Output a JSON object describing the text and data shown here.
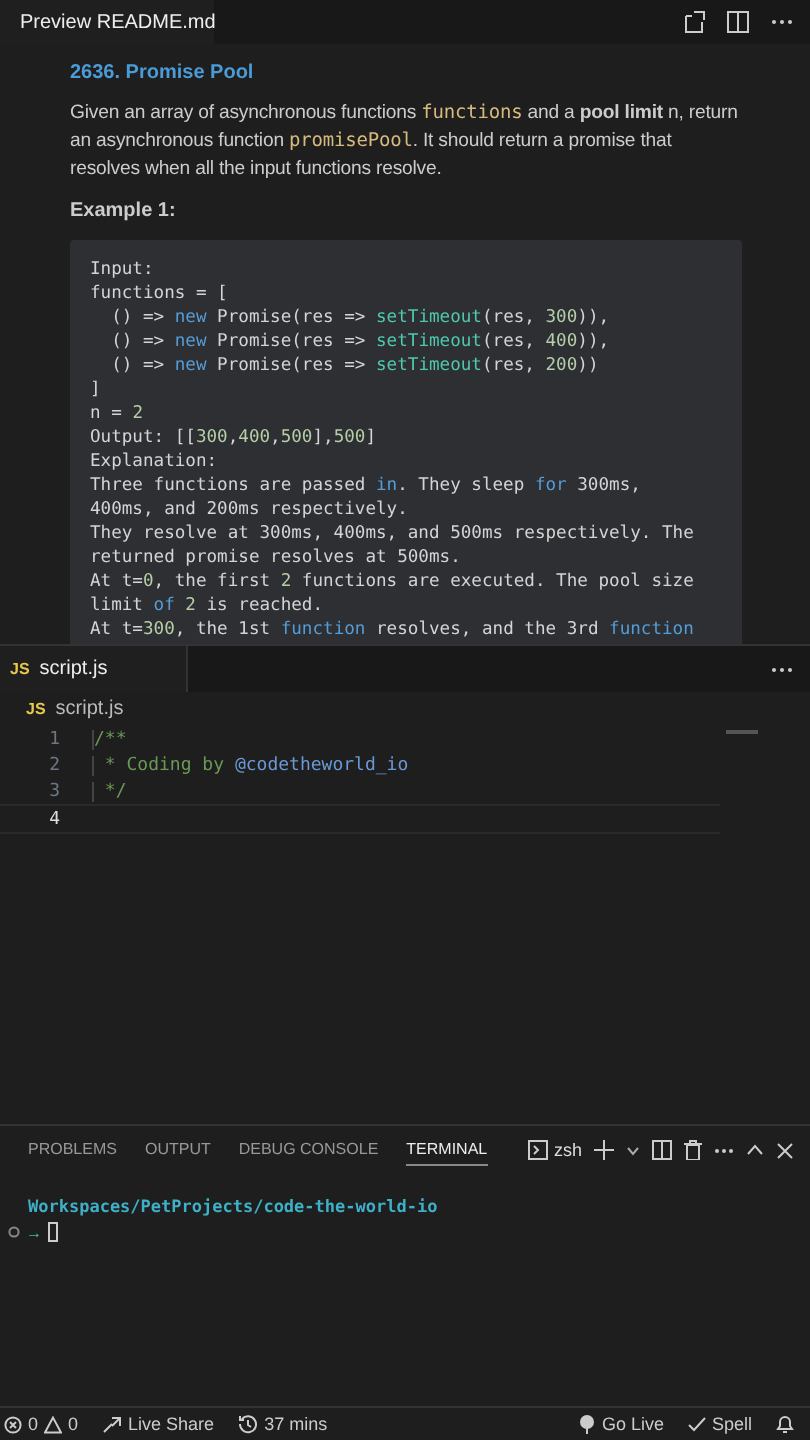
{
  "preview_tab": {
    "title": "Preview README.md"
  },
  "readme": {
    "heading": "2636. Promise Pool",
    "paragraph": [
      {
        "kind": "text",
        "text": "Given an array of asynchronous functions "
      },
      {
        "kind": "code",
        "text": "functions"
      },
      {
        "kind": "text",
        "text": " and a **pool limit** n, return an asynchronous function "
      },
      {
        "kind": "code",
        "text": "promisePool"
      },
      {
        "kind": "text",
        "text": ". It should return a promise that resolves when all the input functions resolve."
      }
    ],
    "example_heading": "Example 1:",
    "code_lines": [
      [
        {
          "kind": "plain",
          "text": "Input:"
        }
      ],
      [
        {
          "kind": "plain",
          "text": "functions = ["
        }
      ],
      [
        {
          "kind": "plain",
          "text": "  () => "
        },
        {
          "kind": "keyword",
          "text": "new"
        },
        {
          "kind": "plain",
          "text": " Promise(res => "
        },
        {
          "kind": "func",
          "text": "setTimeout"
        },
        {
          "kind": "plain",
          "text": "(res, "
        },
        {
          "kind": "number",
          "text": "300"
        },
        {
          "kind": "plain",
          "text": ")),"
        }
      ],
      [
        {
          "kind": "plain",
          "text": "  () => "
        },
        {
          "kind": "keyword",
          "text": "new"
        },
        {
          "kind": "plain",
          "text": " Promise(res => "
        },
        {
          "kind": "func",
          "text": "setTimeout"
        },
        {
          "kind": "plain",
          "text": "(res, "
        },
        {
          "kind": "number",
          "text": "400"
        },
        {
          "kind": "plain",
          "text": ")),"
        }
      ],
      [
        {
          "kind": "plain",
          "text": "  () => "
        },
        {
          "kind": "keyword",
          "text": "new"
        },
        {
          "kind": "plain",
          "text": " Promise(res => "
        },
        {
          "kind": "func",
          "text": "setTimeout"
        },
        {
          "kind": "plain",
          "text": "(res, "
        },
        {
          "kind": "number",
          "text": "200"
        },
        {
          "kind": "plain",
          "text": "))"
        }
      ],
      [
        {
          "kind": "plain",
          "text": "]"
        }
      ],
      [
        {
          "kind": "plain",
          "text": "n = "
        },
        {
          "kind": "number",
          "text": "2"
        }
      ],
      [
        {
          "kind": "plain",
          "text": "Output: [["
        },
        {
          "kind": "number",
          "text": "300"
        },
        {
          "kind": "plain",
          "text": ","
        },
        {
          "kind": "number",
          "text": "400"
        },
        {
          "kind": "plain",
          "text": ","
        },
        {
          "kind": "number",
          "text": "500"
        },
        {
          "kind": "plain",
          "text": "],"
        },
        {
          "kind": "number",
          "text": "500"
        },
        {
          "kind": "plain",
          "text": "]"
        }
      ],
      [
        {
          "kind": "plain",
          "text": "Explanation:"
        }
      ],
      [
        {
          "kind": "plain",
          "text": "Three functions are passed "
        },
        {
          "kind": "keyword",
          "text": "in"
        },
        {
          "kind": "plain",
          "text": ". They sleep "
        },
        {
          "kind": "keyword",
          "text": "for"
        },
        {
          "kind": "plain",
          "text": " 300ms,"
        }
      ],
      [
        {
          "kind": "plain",
          "text": "400ms, and 200ms respectively."
        }
      ],
      [
        {
          "kind": "plain",
          "text": "They resolve at 300ms, 400ms, and 500ms respectively. The"
        }
      ],
      [
        {
          "kind": "plain",
          "text": "returned promise resolves at 500ms."
        }
      ],
      [
        {
          "kind": "plain",
          "text": "At t="
        },
        {
          "kind": "number",
          "text": "0"
        },
        {
          "kind": "plain",
          "text": ", the first "
        },
        {
          "kind": "number",
          "text": "2"
        },
        {
          "kind": "plain",
          "text": " functions are executed. The pool size"
        }
      ],
      [
        {
          "kind": "plain",
          "text": "limit "
        },
        {
          "kind": "keyword",
          "text": "of "
        },
        {
          "kind": "number",
          "text": "2"
        },
        {
          "kind": "plain",
          "text": " is reached."
        }
      ],
      [
        {
          "kind": "plain",
          "text": "At t="
        },
        {
          "kind": "number",
          "text": "300"
        },
        {
          "kind": "plain",
          "text": ", the 1st "
        },
        {
          "kind": "keyword",
          "text": "function"
        },
        {
          "kind": "plain",
          "text": " resolves, and the 3rd "
        },
        {
          "kind": "keyword",
          "text": "function"
        }
      ]
    ]
  },
  "editor_tab": {
    "badge": "JS",
    "title": "script.js"
  },
  "breadcrumb": {
    "badge": "JS",
    "title": "script.js"
  },
  "editor_lines": [
    {
      "number": "1",
      "active": false,
      "tokens": [
        {
          "kind": "comment",
          "text": "/**"
        }
      ]
    },
    {
      "number": "2",
      "active": false,
      "tokens": [
        {
          "kind": "comment",
          "text": " * Coding by "
        },
        {
          "kind": "tag",
          "text": "@codetheworld_io"
        }
      ]
    },
    {
      "number": "3",
      "active": false,
      "tokens": [
        {
          "kind": "comment",
          "text": " */"
        }
      ]
    },
    {
      "number": "4",
      "active": true
    }
  ],
  "panel_tabs": [
    {
      "label": "PROBLEMS",
      "selected": false
    },
    {
      "label": "OUTPUT",
      "selected": false
    },
    {
      "label": "DEBUG CONSOLE",
      "selected": false
    },
    {
      "label": "TERMINAL",
      "selected": true
    }
  ],
  "terminal_shell": "zsh",
  "terminal": {
    "path": "Workspaces/PetProjects/code-the-world-io",
    "prompt": "→"
  },
  "status_bar": {
    "errors": "0",
    "warnings": "0",
    "live_share": "Live Share",
    "timer": "37 mins",
    "go_live": "Go Live",
    "spell": "Spell"
  }
}
